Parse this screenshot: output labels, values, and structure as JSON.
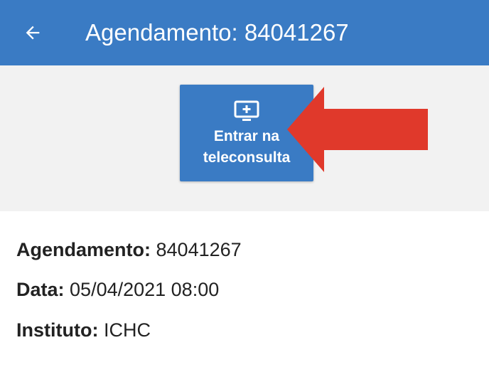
{
  "header": {
    "title": "Agendamento: 84041267",
    "back_icon": "arrow-left-icon"
  },
  "teleconsulta_button": {
    "icon": "monitor-plus-icon",
    "label_line1": "Entrar na",
    "label_line2": "teleconsulta"
  },
  "details": [
    {
      "label": "Agendamento:",
      "value": "84041267"
    },
    {
      "label": "Data:",
      "value": "05/04/2021 08:00"
    },
    {
      "label": "Instituto:",
      "value": "ICHC"
    }
  ],
  "colors": {
    "primary": "#3a7bc4",
    "annotation_arrow": "#e0392b",
    "background": "#f2f2f2",
    "card": "#ffffff"
  }
}
